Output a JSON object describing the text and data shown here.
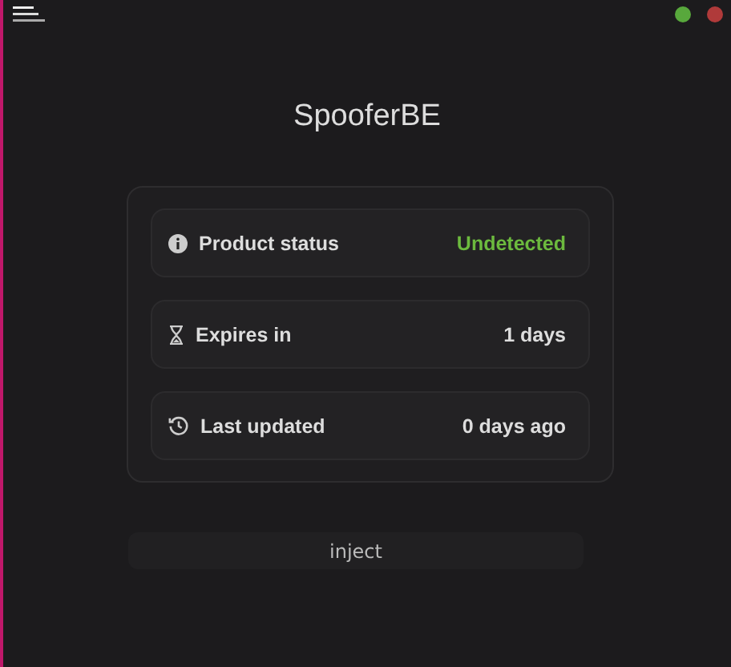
{
  "app": {
    "title": "SpooferBE"
  },
  "info_rows": [
    {
      "kind": "status",
      "label": "Product status",
      "value": "Undetected"
    },
    {
      "kind": "expiry",
      "label": "Expires in",
      "value": "1 days"
    },
    {
      "kind": "update",
      "label": "Last updated",
      "value": "0 days ago"
    }
  ],
  "buttons": [
    {
      "label": "inject"
    }
  ]
}
